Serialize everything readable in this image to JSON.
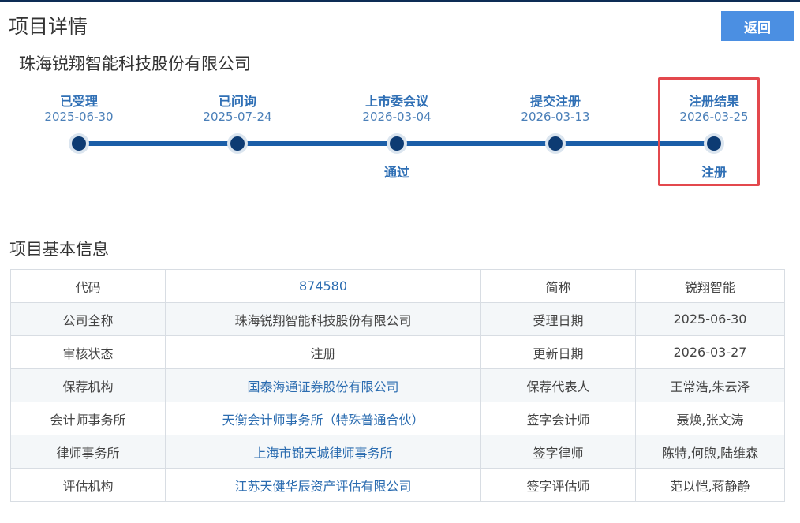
{
  "page_title": "项目详情",
  "back_label": "返回",
  "company_name": "珠海锐翔智能科技股份有限公司",
  "timeline": {
    "steps": [
      {
        "label": "已受理",
        "date": "2025-06-30",
        "result": ""
      },
      {
        "label": "已问询",
        "date": "2025-07-24",
        "result": ""
      },
      {
        "label": "上市委会议",
        "date": "2026-03-04",
        "result": "通过"
      },
      {
        "label": "提交注册",
        "date": "2026-03-13",
        "result": ""
      },
      {
        "label": "注册结果",
        "date": "2026-03-25",
        "result": "注册"
      }
    ]
  },
  "section_title": "项目基本信息",
  "info_table": {
    "rows": [
      {
        "k1": "代码",
        "v1": "874580",
        "k2": "简称",
        "v2": "锐翔智能"
      },
      {
        "k1": "公司全称",
        "v1": "珠海锐翔智能科技股份有限公司",
        "k2": "受理日期",
        "v2": "2025-06-30"
      },
      {
        "k1": "审核状态",
        "v1": "注册",
        "k2": "更新日期",
        "v2": "2026-03-27"
      },
      {
        "k1": "保荐机构",
        "v1": "国泰海通证券股份有限公司",
        "k2": "保荐代表人",
        "v2": "王常浩,朱云泽"
      },
      {
        "k1": "会计师事务所",
        "v1": "天衡会计师事务所（特殊普通合伙）",
        "k2": "签字会计师",
        "v2": "聂焕,张文涛"
      },
      {
        "k1": "律师事务所",
        "v1": "上海市锦天城律师事务所",
        "k2": "签字律师",
        "v2": "陈特,何煦,陆维森"
      },
      {
        "k1": "评估机构",
        "v1": "江苏天健华辰资产评估有限公司",
        "k2": "签字评估师",
        "v2": "范以恺,蒋静静"
      }
    ]
  },
  "colors": {
    "accent_button": "#4b8fe2",
    "timeline_line": "#1b5ea8",
    "timeline_text": "#2f6fb5",
    "highlight": "#e3484d",
    "link": "#2b6cb0"
  }
}
